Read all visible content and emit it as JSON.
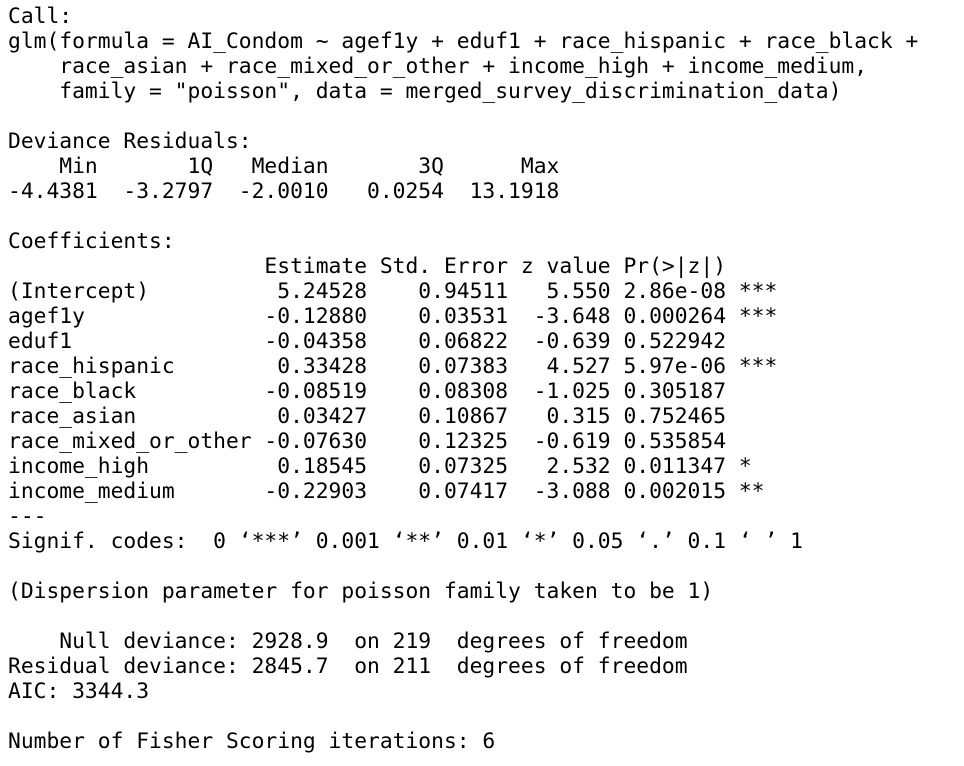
{
  "output": {
    "lines": [
      "Call:",
      "glm(formula = AI_Condom ~ agef1y + eduf1 + race_hispanic + race_black +",
      "    race_asian + race_mixed_or_other + income_high + income_medium,",
      "    family = \"poisson\", data = merged_survey_discrimination_data)",
      "",
      "Deviance Residuals:",
      "    Min       1Q   Median       3Q      Max",
      "-4.4381  -3.2797  -2.0010   0.0254  13.1918",
      "",
      "Coefficients:",
      "                    Estimate Std. Error z value Pr(>|z|)    ",
      "(Intercept)          5.24528    0.94511   5.550 2.86e-08 ***",
      "agef1y              -0.12880    0.03531  -3.648 0.000264 ***",
      "eduf1               -0.04358    0.06822  -0.639 0.522942    ",
      "race_hispanic        0.33428    0.07383   4.527 5.97e-06 ***",
      "race_black          -0.08519    0.08308  -1.025 0.305187    ",
      "race_asian           0.03427    0.10867   0.315 0.752465    ",
      "race_mixed_or_other -0.07630    0.12325  -0.619 0.535854    ",
      "income_high          0.18545    0.07325   2.532 0.011347 *  ",
      "income_medium       -0.22903    0.07417  -3.088 0.002015 ** ",
      "---",
      "Signif. codes:  0 ‘***’ 0.001 ‘**’ 0.01 ‘*’ 0.05 ‘.’ 0.1 ‘ ’ 1",
      "",
      "(Dispersion parameter for poisson family taken to be 1)",
      "",
      "    Null deviance: 2928.9  on 219  degrees of freedom",
      "Residual deviance: 2845.7  on 211  degrees of freedom",
      "AIC: 3344.3",
      "",
      "Number of Fisher Scoring iterations: 6"
    ]
  }
}
